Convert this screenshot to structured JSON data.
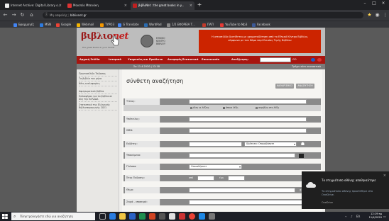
{
  "tabs": [
    {
      "label": "Internet Archive: Digital Library o...",
      "favicon_color": "#ffffff"
    },
    {
      "label": "Μουσείο Μπενάκη",
      "favicon_color": "#e7e7e7"
    },
    {
      "label": "βιβλιΝet : the great books in y...",
      "favicon_color": "#c02020"
    }
  ],
  "browser": {
    "url": "biblionet.gr",
    "lock_label": "Μη ασφαλής",
    "bookmarks": [
      {
        "label": "Εφαρμογές",
        "color": "#4285f4"
      },
      {
        "label": "MSN",
        "color": "#2d7be0"
      },
      {
        "label": "Google",
        "color": "#ea4335"
      },
      {
        "label": "Webmail",
        "color": "#f4b400"
      },
      {
        "label": "TYPO3",
        "color": "#f49700"
      },
      {
        "label": "G Translate",
        "color": "#4285f4"
      },
      {
        "label": "WordPad",
        "color": "#2b6cb0"
      },
      {
        "label": "1/2 ΕΦΟΡΕΙΑ Τ...",
        "color": "#888888"
      },
      {
        "label": "ΠΑΠ",
        "color": "#c0392b"
      },
      {
        "label": "YouTube to Mp3",
        "color": "#e53935"
      },
      {
        "label": "Facebook",
        "color": "#3b5998"
      }
    ]
  },
  "site": {
    "logo_main": "βιβλιο",
    "logo_net": "net",
    "logo_tagline": "the great books in your hands",
    "ekebi_lines": [
      "ΕΘΝΙΚΟ",
      "ΚΕΝΤΡΟ",
      "ΒΙΒΛΙΟΥ"
    ],
    "notice": "Η ιστοσελίδα διατίθεται με χρηματοδότηση από το Εθνικό Κέντρο Βιβλίου, σύμφωνα με τον Νόμο περί Ενιαίας Τιμής Βιβλίου",
    "menu": [
      "Αρχική Σελίδα",
      "Ιστορικό",
      "Υπηρεσίες και Προϊόντα",
      "Αναφορές/Στατιστικά",
      "Επικοινωνία"
    ],
    "search_label": "Αναζήτηση:",
    "go_label": "GO",
    "date": "Σα 11.4.2020  |  12:18",
    "subbar_right": "Τρέχει κάτι ουσιαστικά",
    "sidebar": [
      "Πρωτοσέλιδο Έκδοσης",
      "Τα βιβλία του μήνα",
      "Νέες κυκλοφορίες",
      "Αφιερωματικά βιβλία",
      "Ενδιαφέρον για τα βιβλία σε όλη την ΕΛΛΑΔΑ",
      "Στατιστικά της Ελληνικής Βιβλιοπαραγωγής 2021"
    ],
    "page_title": "σύνθετη αναζήτηση",
    "btn_clear": "ΚΑΘΑΡΙΣΜΟΣ",
    "btn_search": "ΑΝΑΖΗΤΗΣΗ",
    "fields": {
      "title": "Τίτλος:",
      "radio_all": "όλες οι λέξεις",
      "radio_any": "όποια λέξη",
      "radio_exact": "ακριβώς στη λέξη",
      "subtitle": "Υπότιτλος:",
      "isbn": "ISBN:",
      "publisher": "Εκδότης:",
      "publisher_role": "Ιδιότητα: Οποιαδήποτε",
      "subject": "Υποκείμενο:",
      "language": "Γλώσσα:",
      "language_value": "Οποιαδήποτε",
      "year": "Έτος Έκδοσης:",
      "year_from": "από",
      "year_to": "έως",
      "theme": "Θέμα:",
      "series": "Σειρά - υποσειρά:"
    }
  },
  "toast": {
    "title": "Το στιγμιότυπο οθόνης αποθηκεύτηκε",
    "body": "Το στιγμιότυπο οθόνης προστέθηκε στο OneDrive.",
    "app": "OneDrive",
    "close": "×"
  },
  "taskbar": {
    "search_placeholder": "Πληκτρολογήστε εδώ για αναζήτηση",
    "time": "12:19 πμ",
    "date": "11/4/2020"
  }
}
